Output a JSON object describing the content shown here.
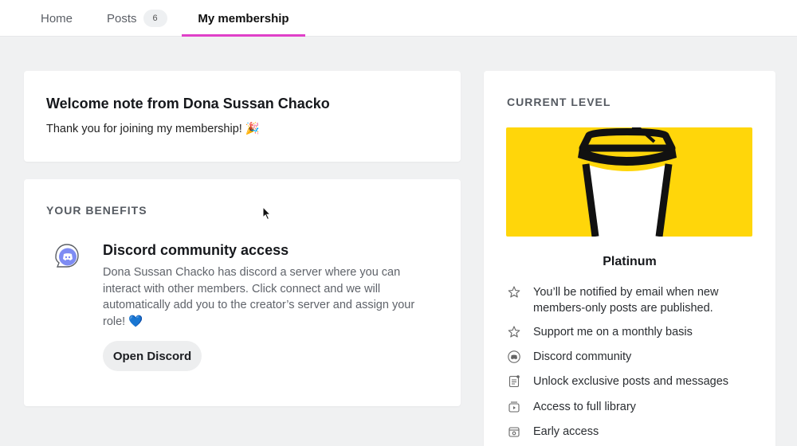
{
  "nav": {
    "tabs": [
      {
        "label": "Home"
      },
      {
        "label": "Posts",
        "badge": "6"
      },
      {
        "label": "My membership",
        "active": true
      }
    ],
    "accent": "#e040c9"
  },
  "welcome": {
    "title": "Welcome note from Dona Sussan Chacko",
    "body": "Thank you for joining my membership! 🎉"
  },
  "benefits": {
    "heading": "YOUR BENEFITS",
    "items": [
      {
        "icon": "discord-chat-icon",
        "title": "Discord community access",
        "description": "Dona Sussan Chacko has discord a server where you can interact with other members. Click connect and we will automatically add you to the creator’s server and assign your role! 💙",
        "button": "Open Discord"
      }
    ]
  },
  "level": {
    "heading": "CURRENT LEVEL",
    "art_background": "#ffd60a",
    "tier": "Platinum",
    "perks": [
      {
        "icon": "star-icon",
        "text": "You’ll be notified by email when new members-only posts are published."
      },
      {
        "icon": "star-icon",
        "text": "Support me on a monthly basis"
      },
      {
        "icon": "discord-icon",
        "text": "Discord community"
      },
      {
        "icon": "document-icon",
        "text": "Unlock exclusive posts and messages"
      },
      {
        "icon": "library-icon",
        "text": "Access to full library"
      },
      {
        "icon": "early-access-icon",
        "text": "Early access"
      }
    ]
  }
}
